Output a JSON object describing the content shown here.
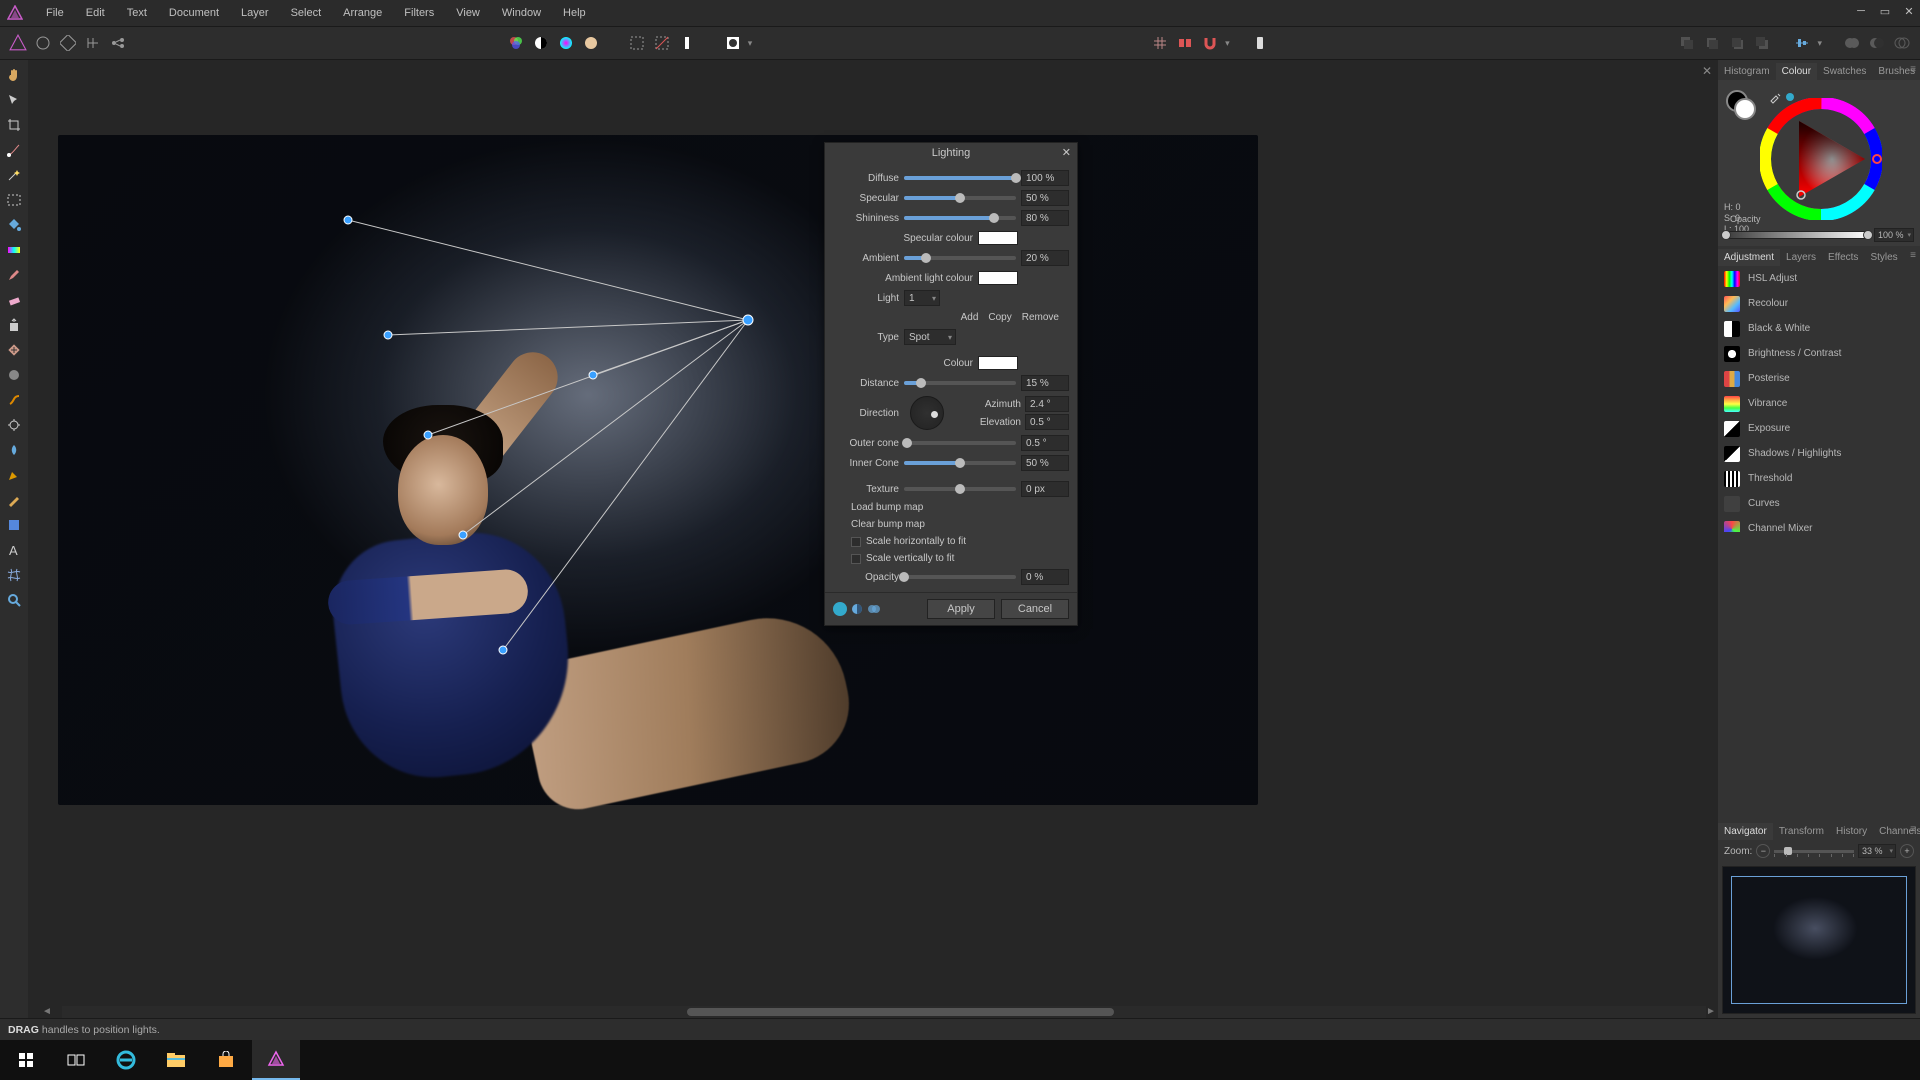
{
  "menu": {
    "items": [
      "File",
      "Edit",
      "Text",
      "Document",
      "Layer",
      "Select",
      "Arrange",
      "Filters",
      "View",
      "Window",
      "Help"
    ]
  },
  "dialog": {
    "title": "Lighting",
    "diffuse": {
      "label": "Diffuse",
      "value": "100 %",
      "pct": 100
    },
    "specular": {
      "label": "Specular",
      "value": "50 %",
      "pct": 50
    },
    "shininess": {
      "label": "Shininess",
      "value": "80 %",
      "pct": 80
    },
    "specular_colour_label": "Specular colour",
    "ambient": {
      "label": "Ambient",
      "value": "20 %",
      "pct": 20
    },
    "ambient_colour_label": "Ambient light colour",
    "light_label": "Light",
    "light_sel": "1",
    "add": "Add",
    "copy": "Copy",
    "remove": "Remove",
    "type_label": "Type",
    "type_sel": "Spot",
    "colour_label": "Colour",
    "distance": {
      "label": "Distance",
      "value": "15 %",
      "pct": 15
    },
    "direction_label": "Direction",
    "azimuth": {
      "label": "Azimuth",
      "value": "2.4 °"
    },
    "elevation": {
      "label": "Elevation",
      "value": "0.5 °"
    },
    "outer": {
      "label": "Outer cone",
      "value": "0.5 °",
      "pct": 3
    },
    "inner": {
      "label": "Inner Cone",
      "value": "50 %",
      "pct": 50
    },
    "texture": {
      "label": "Texture",
      "value": "0 px",
      "pct": 50
    },
    "load_bump": "Load bump map",
    "clear_bump": "Clear bump map",
    "scale_h": "Scale horizontally to fit",
    "scale_v": "Scale vertically to fit",
    "opacity": {
      "label": "Opacity",
      "value": "0 %",
      "pct": 0
    },
    "apply": "Apply",
    "cancel": "Cancel"
  },
  "right": {
    "tabs1": [
      "Histogram",
      "Colour",
      "Swatches",
      "Brushes"
    ],
    "hsv": {
      "h": "H: 0",
      "s": "S: 0",
      "l": "L: 100",
      "opacity_label": "Opacity",
      "opacity": "100 %"
    },
    "tabs2": [
      "Adjustment",
      "Layers",
      "Effects",
      "Styles"
    ],
    "adjustments": [
      {
        "name": "HSL Adjust",
        "bg": "linear-gradient(90deg,#f00,#ff0,#0f0,#0ff,#00f,#f0f,#f00)"
      },
      {
        "name": "Recolour",
        "bg": "linear-gradient(135deg,#f55,#fb5,#5bf,#55f)"
      },
      {
        "name": "Black & White",
        "bg": "linear-gradient(90deg,#fff 50%,#000 50%)"
      },
      {
        "name": "Brightness / Contrast",
        "bg": "radial-gradient(circle,#fff 35%,#000 36%)"
      },
      {
        "name": "Posterise",
        "bg": "linear-gradient(90deg,#d44 33%,#da4 33% 66%,#48d 66%)"
      },
      {
        "name": "Vibrance",
        "bg": "linear-gradient(#f44,#fa4,#ff4,#4f4,#4ff)"
      },
      {
        "name": "Exposure",
        "bg": "linear-gradient(135deg,#fff 50%,#000 50%)"
      },
      {
        "name": "Shadows / Highlights",
        "bg": "linear-gradient(135deg,#000 50%,#fff 50%)"
      },
      {
        "name": "Threshold",
        "bg": "repeating-linear-gradient(90deg,#000 0 2px,#fff 2px 4px)"
      },
      {
        "name": "Curves",
        "bg": "#404040"
      },
      {
        "name": "Channel Mixer",
        "bg": "conic-gradient(#f44,#4f4,#44f,#f44)"
      }
    ],
    "tabs3": [
      "Navigator",
      "Transform",
      "History",
      "Channels"
    ],
    "zoom_label": "Zoom:",
    "zoom_value": "33 %"
  },
  "status": {
    "bold": "DRAG",
    "text": "handles to position lights."
  }
}
